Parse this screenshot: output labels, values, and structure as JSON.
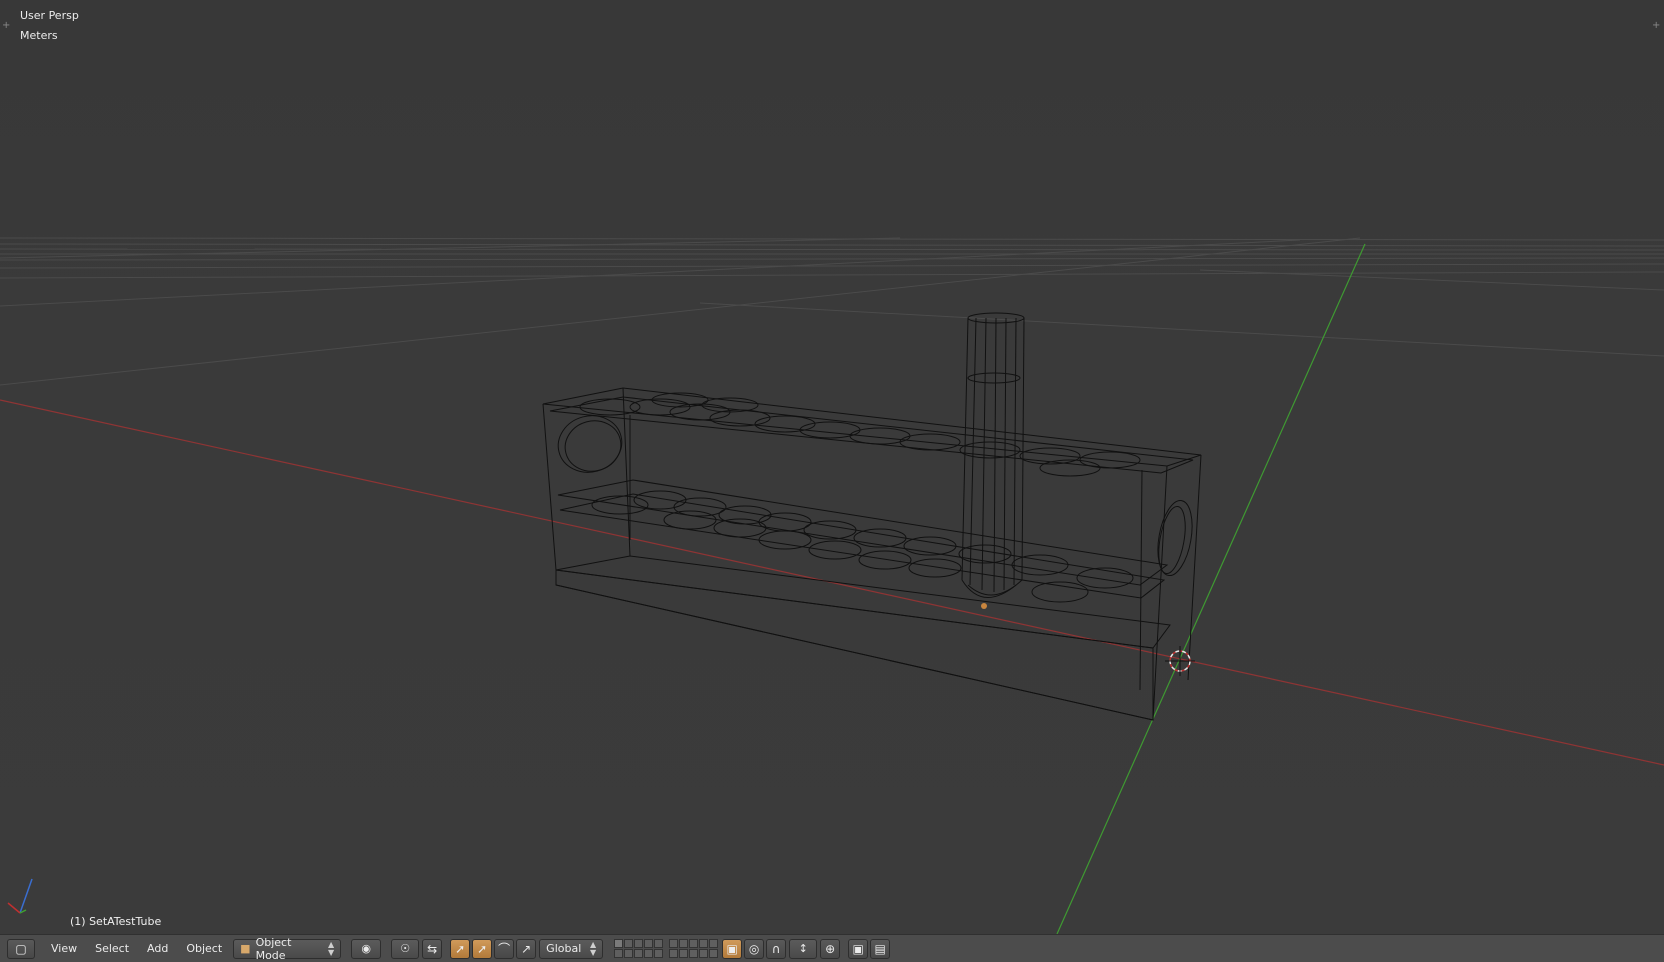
{
  "viewport": {
    "view_name": "User Persp",
    "units": "Meters",
    "object_label": "(1) SetATestTube"
  },
  "header": {
    "menus": [
      "View",
      "Select",
      "Add",
      "Object"
    ],
    "mode": "Object Mode",
    "orientation": "Global"
  },
  "icons": {
    "editor_type": "cube-icon",
    "viewport_shading": "sphere-icon",
    "pivot": "pivot-icon",
    "manipulator": "manipulator-icon",
    "translate": "translate-icon",
    "rotate": "rotate-icon",
    "scale": "scale-icon",
    "layers": "layers-icon",
    "lock": "lock-icon",
    "proportional": "proportional-edit-icon",
    "snap": "magnet-icon",
    "render": "camera-icon"
  },
  "colors": {
    "x_axis": "#a53a3a",
    "y_axis": "#4aa53a",
    "grid": "#4d4d4d",
    "wire": "#0d0d0d",
    "active": "#c8853e"
  }
}
